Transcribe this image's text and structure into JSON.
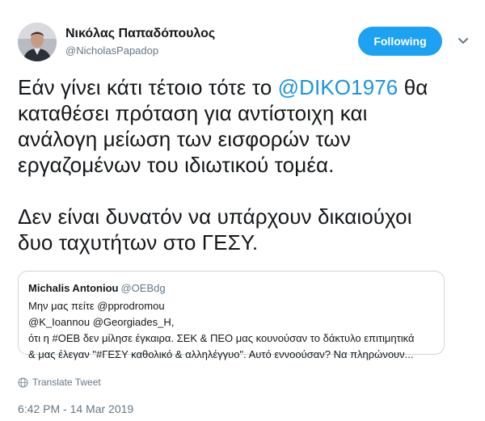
{
  "author": {
    "name": "Νικόλας Παπαδόπουλος",
    "handle": "@NicholasPapadop"
  },
  "follow_button": {
    "label": "Following"
  },
  "icons": {
    "more": "chevron-down-icon",
    "translate": "globe-icon"
  },
  "colors": {
    "accent": "#1da1f2",
    "link": "#1b95e0",
    "muted": "#657786",
    "border": "#ccd6dd"
  },
  "tweet": {
    "p1_l1_pre": "Εάν γίνει κάτι τέτοιο τότε το ",
    "p1_mention": "@DIKO1976",
    "p1_l1_post": " θα",
    "p1_l2": "καταθέσει πρόταση για αντίστοιχη και",
    "p1_l3": "ανάλογη μείωση των εισφορών των",
    "p1_l4": "εργαζομένων του ιδιωτικού τομέα.",
    "p2_l1": "Δεν είναι δυνατόν να υπάρχουν δικαιούχοι",
    "p2_l2": "δυο ταχυτήτων στο ΓΕΣΥ."
  },
  "quoted": {
    "name": "Michalis Antoniou",
    "handle": "@OEBdg",
    "l1": "Μην μας πείτε @pprodromou",
    "l2": "@K_Ioannou @Georgiades_H,",
    "l3": "ότι η #ΟΕΒ δεν μίλησε έγκαιρα. ΣΕΚ & ΠΕΟ μας κουνούσαν το δάκτυλο επιτιμητικά",
    "l4": "& μας έλεγαν \"#ΓΕΣΥ καθολικό & αλληλέγγυο\". Αυτό εννοούσαν? Να πληρώνουν..."
  },
  "translate_label": "Translate Tweet",
  "timestamp": "6:42 PM - 14 Mar 2019"
}
